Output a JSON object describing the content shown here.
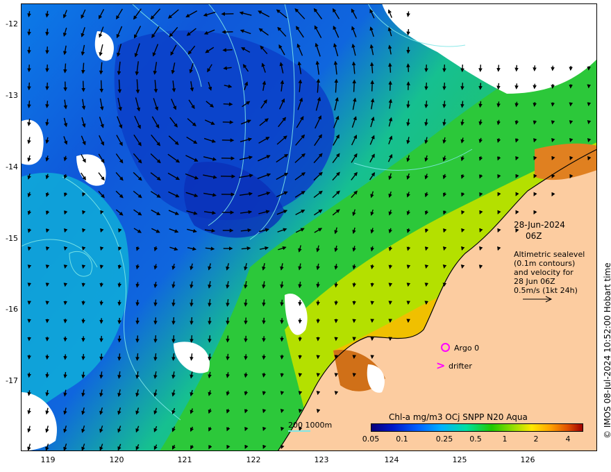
{
  "map": {
    "lat_ticks": [
      "-12",
      "-13",
      "-14",
      "-15",
      "-16",
      "-17"
    ],
    "lon_ticks": [
      "119",
      "120",
      "121",
      "122",
      "123",
      "124",
      "125",
      "126"
    ],
    "land_color": "#fccca0",
    "cloud_color": "#ffffff"
  },
  "annotations": {
    "date_line1": "28-Jun-2024",
    "date_line2": "06Z",
    "legend_lines": [
      "Altimetric sealevel",
      "(0.1m contours)",
      "and velocity for",
      "28 Jun 06Z",
      "0.5m/s (1kt 24h)"
    ],
    "argo_label": "Argo 0",
    "drifter_symbol": ">",
    "drifter_label": "drifter",
    "bathy_label": "200  1000m",
    "credit": "© IMOS 08-Jul-2024 10:52:00 Hobart time"
  },
  "colorbar": {
    "title": "Chl-a mg/m3 OCj SNPP N20 Aqua",
    "ticks": [
      "0.05",
      "0.1",
      "0.25",
      "0.5",
      "1",
      "2",
      "4"
    ]
  },
  "colors": {
    "marker": "#ff00ff",
    "contour": "#7fe7e7"
  }
}
